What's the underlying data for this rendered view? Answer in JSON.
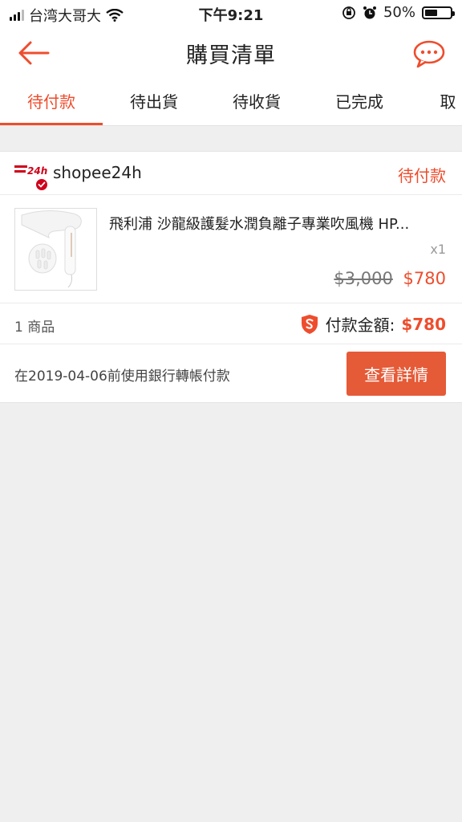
{
  "status_bar": {
    "carrier": "台湾大哥大",
    "time": "下午9:21",
    "battery_percent": "50%",
    "battery_level": 0.5,
    "icons": [
      "signal-icon",
      "wifi-icon",
      "rotation-lock-icon",
      "alarm-icon",
      "battery-icon"
    ]
  },
  "nav": {
    "title": "購買清單",
    "back_icon": "back-arrow-icon",
    "chat_icon": "chat-icon"
  },
  "tabs": [
    {
      "label": "待付款",
      "active": true
    },
    {
      "label": "待出貨",
      "active": false
    },
    {
      "label": "待收貨",
      "active": false
    },
    {
      "label": "已完成",
      "active": false
    },
    {
      "label": "取消",
      "active": false
    }
  ],
  "order": {
    "shop_logo_text": "24h",
    "shop_name": "shopee24h",
    "status": "待付款",
    "product": {
      "name": "飛利浦 沙龍級護髮水潤負離子專業吹風機 HP...",
      "quantity": "x1",
      "original_price": "$3,000",
      "price": "$780"
    },
    "item_count": "1 商品",
    "total_label": "付款金額:",
    "total_amount": "$780",
    "payment_note": "在2019-04-06前使用銀行轉帳付款",
    "detail_button": "查看詳情"
  },
  "colors": {
    "accent": "#ee4d2d",
    "button": "#e55a37",
    "background": "#efefef"
  }
}
